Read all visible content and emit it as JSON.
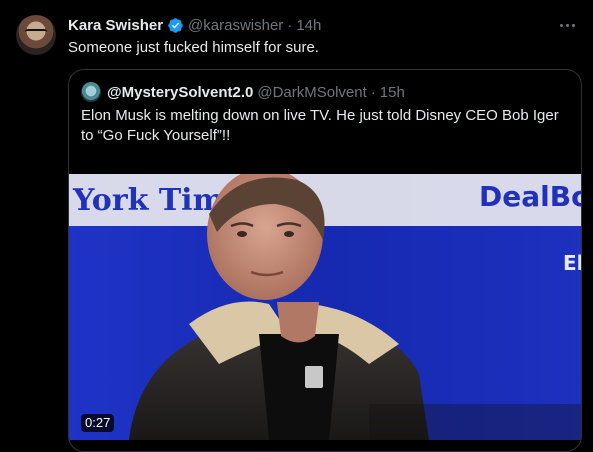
{
  "tweet": {
    "author_name": "Kara Swisher",
    "handle": "@karaswisher",
    "separator": "·",
    "time": "14h",
    "text": "Someone just fucked himself for sure."
  },
  "quote": {
    "author_name": "@MysterySolvent2.0",
    "handle": "@DarkMSolvent",
    "separator": "·",
    "time": "15h",
    "text": "Elon Musk is melting down on live TV. He just told Disney CEO Bob Iger to “Go Fuck Yourself”!!"
  },
  "media": {
    "backdrop_left_text": "York Times",
    "backdrop_right_text": "DealBo",
    "backdrop_right_small": "El",
    "duration": "0:27"
  },
  "colors": {
    "background": "#000000",
    "text_primary": "#e7e9ea",
    "text_secondary": "#71767b",
    "verified": "#1d9bf0",
    "border": "#2f3336",
    "stage_blue": "#1b2db8"
  },
  "icons": {
    "verified": "verified-badge-icon",
    "more": "more-options-icon"
  }
}
